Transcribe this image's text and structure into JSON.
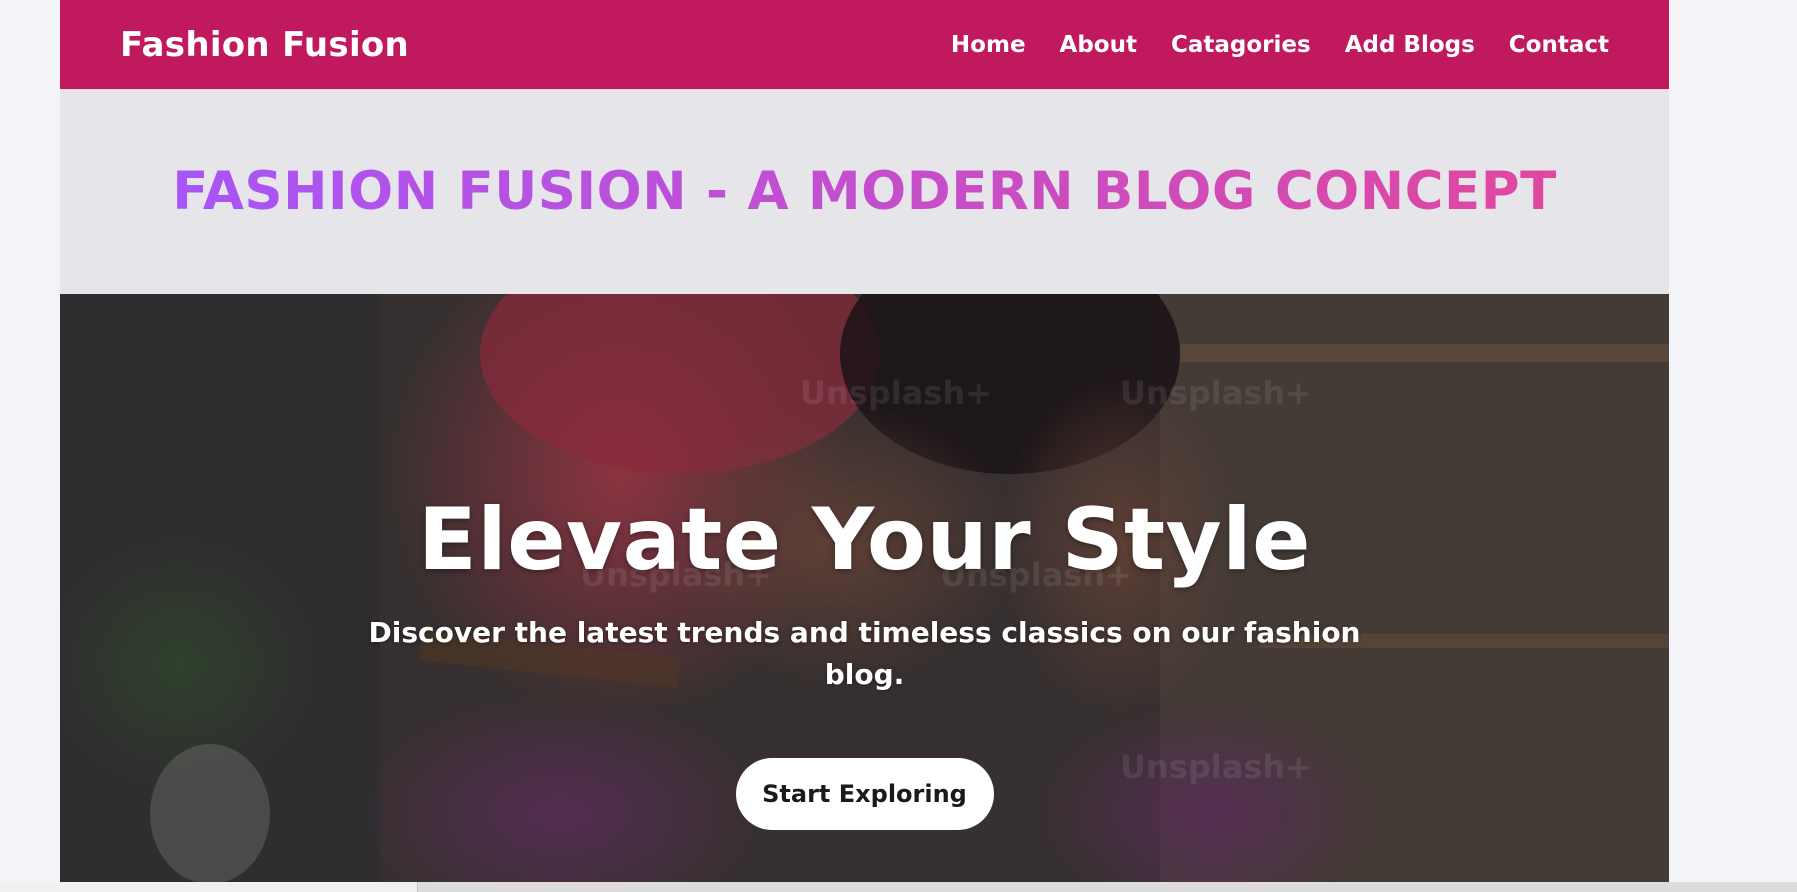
{
  "navbar": {
    "brand": "Fashion Fusion",
    "links": [
      {
        "label": "Home"
      },
      {
        "label": "About"
      },
      {
        "label": "Catagories"
      },
      {
        "label": "Add Blogs"
      },
      {
        "label": "Contact"
      }
    ],
    "background": "#c0195d"
  },
  "banner": {
    "title": "FASHION FUSION - A MODERN BLOG CONCEPT",
    "gradient_start": "#a855f7",
    "gradient_end": "#e0479e"
  },
  "hero": {
    "title": "Elevate Your Style",
    "subtitle": "Discover the latest trends and timeless classics on our fashion blog.",
    "button_label": "Start Exploring",
    "watermark_text": "Unsplash+"
  }
}
